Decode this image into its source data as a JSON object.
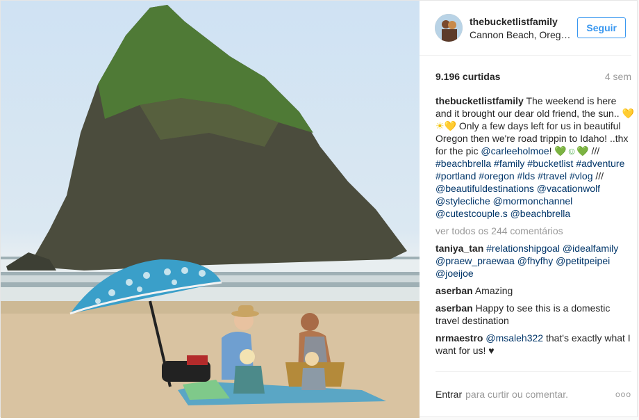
{
  "post": {
    "username": "thebucketlistfamily",
    "location": "Cannon Beach, Oreg…",
    "follow_label": "Seguir",
    "likes": "9.196 curtidas",
    "time_ago": "4 sem",
    "caption": {
      "username": "thebucketlistfamily",
      "part1": " The weekend is here and it brought our dear old friend, the sun.. ",
      "emoji1": "💛☀💛",
      "part2": " Only a few days left for us in beautiful Oregon then we're road trippin to Idaho! ..thx for the pic ",
      "mention1": "@carleeholmoe",
      "part3": "! ",
      "emoji2": "💚☺💚",
      "part4": " /// ",
      "tags1": "#beachbrella #family #bucketlist #adventure #portland #oregon #lds #travel #vlog",
      "part5": " /// ",
      "mentions2": "@beautifuldestinations @vacationwolf @stylecliche @mormonchannel @cutestcouple.s @beachbrella"
    },
    "view_all": "ver todos os 244 comentários",
    "comments": [
      {
        "user": "taniya_tan",
        "text": "#relationshipgoal @idealfamily @praew_praewaa @fhyfhy @petitpeipei @joeijoe",
        "is_link": true
      },
      {
        "user": "aserban",
        "text": "Amazing",
        "is_link": false
      },
      {
        "user": "aserban",
        "text": "Happy to see this is a domestic travel destination",
        "is_link": false
      },
      {
        "user": "nrmaestro",
        "mention": "@msaleh322",
        "text": " that's exactly what I want for us! ♥",
        "is_link": false
      }
    ],
    "footer": {
      "entrar": "Entrar",
      "placeholder": "para curtir ou comentar.",
      "more": "ooo"
    }
  },
  "icons": {
    "more": "ellipsis-icon"
  }
}
